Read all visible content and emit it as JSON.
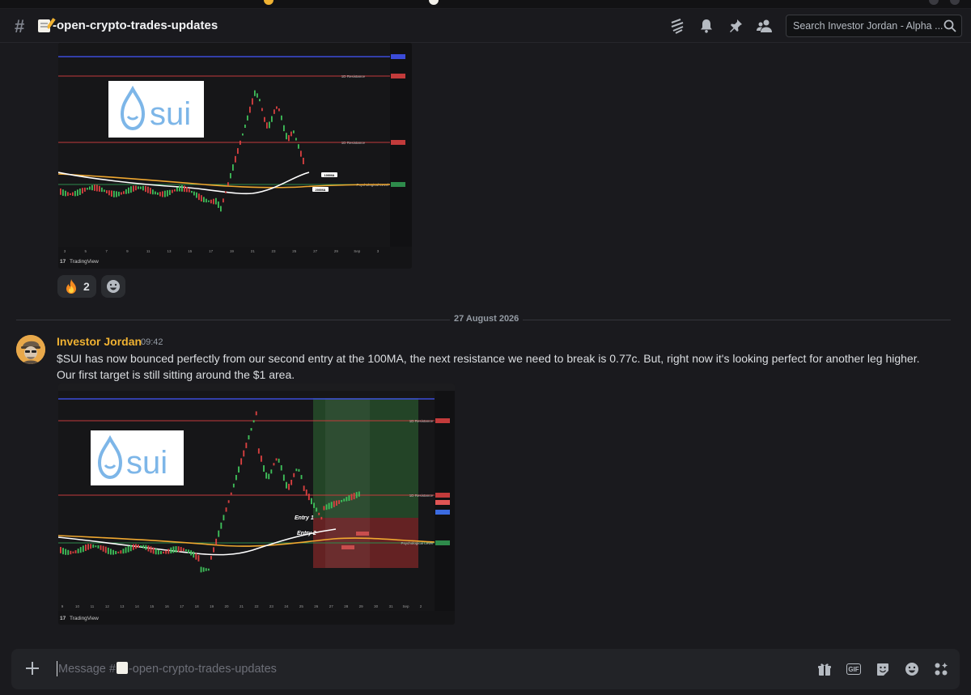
{
  "channel": {
    "name": "-open-crypto-trades-updates",
    "emoji_icon": "memo-icon"
  },
  "search": {
    "placeholder": "Search Investor Jordan - Alpha ..."
  },
  "header_icons": [
    "threads-icon",
    "bell-icon",
    "pin-icon",
    "members-icon"
  ],
  "previous_message": {
    "chart": {
      "logo_text": "sui",
      "watermark": "TradingView",
      "annotations": [
        "1D Resistance",
        "1D Resistance",
        "Psychological Level",
        "100MA",
        "200MA"
      ],
      "x_ticks": [
        "3",
        "5",
        "7",
        "9",
        "11",
        "13",
        "15",
        "17",
        "19",
        "21",
        "23",
        "25",
        "27",
        "29",
        "Sep",
        "3"
      ]
    },
    "reactions": [
      {
        "emoji": "fire-icon",
        "count": "2"
      }
    ]
  },
  "date_divider": "27 August 2026",
  "message": {
    "author": "Investor Jordan",
    "time": "09:42",
    "text": "$SUI has now bounced perfectly from our second entry at the 100MA, the next resistance we need to break is 0.77c. But, right now it's looking perfect for another leg higher. Our first target is still sitting around the $1 area.",
    "chart": {
      "logo_text": "sui",
      "watermark": "TradingView",
      "annotations": [
        "1D Resistance",
        "1D Resistance",
        "Psychological Level"
      ],
      "entries": [
        "Entry 1",
        "Entry 2"
      ],
      "x_ticks": [
        "9",
        "10",
        "11",
        "12",
        "13",
        "14",
        "15",
        "16",
        "17",
        "18",
        "19",
        "20",
        "21",
        "22",
        "23",
        "24",
        "25",
        "26",
        "27",
        "28",
        "29",
        "30",
        "31",
        "Sep",
        "2"
      ]
    }
  },
  "composer": {
    "placeholder_prefix": "Message #",
    "placeholder_channel": "-open-crypto-trades-updates"
  },
  "composer_icons": [
    "gift-icon",
    "gif-icon",
    "sticker-icon",
    "emoji-icon",
    "apps-icon"
  ],
  "colors": {
    "author": "#f0b232",
    "accent": "#5865f2",
    "resistance": "#e74c4c",
    "ma100": "#ffffff",
    "ma200": "#f0b232",
    "psych": "#3ba55c"
  }
}
